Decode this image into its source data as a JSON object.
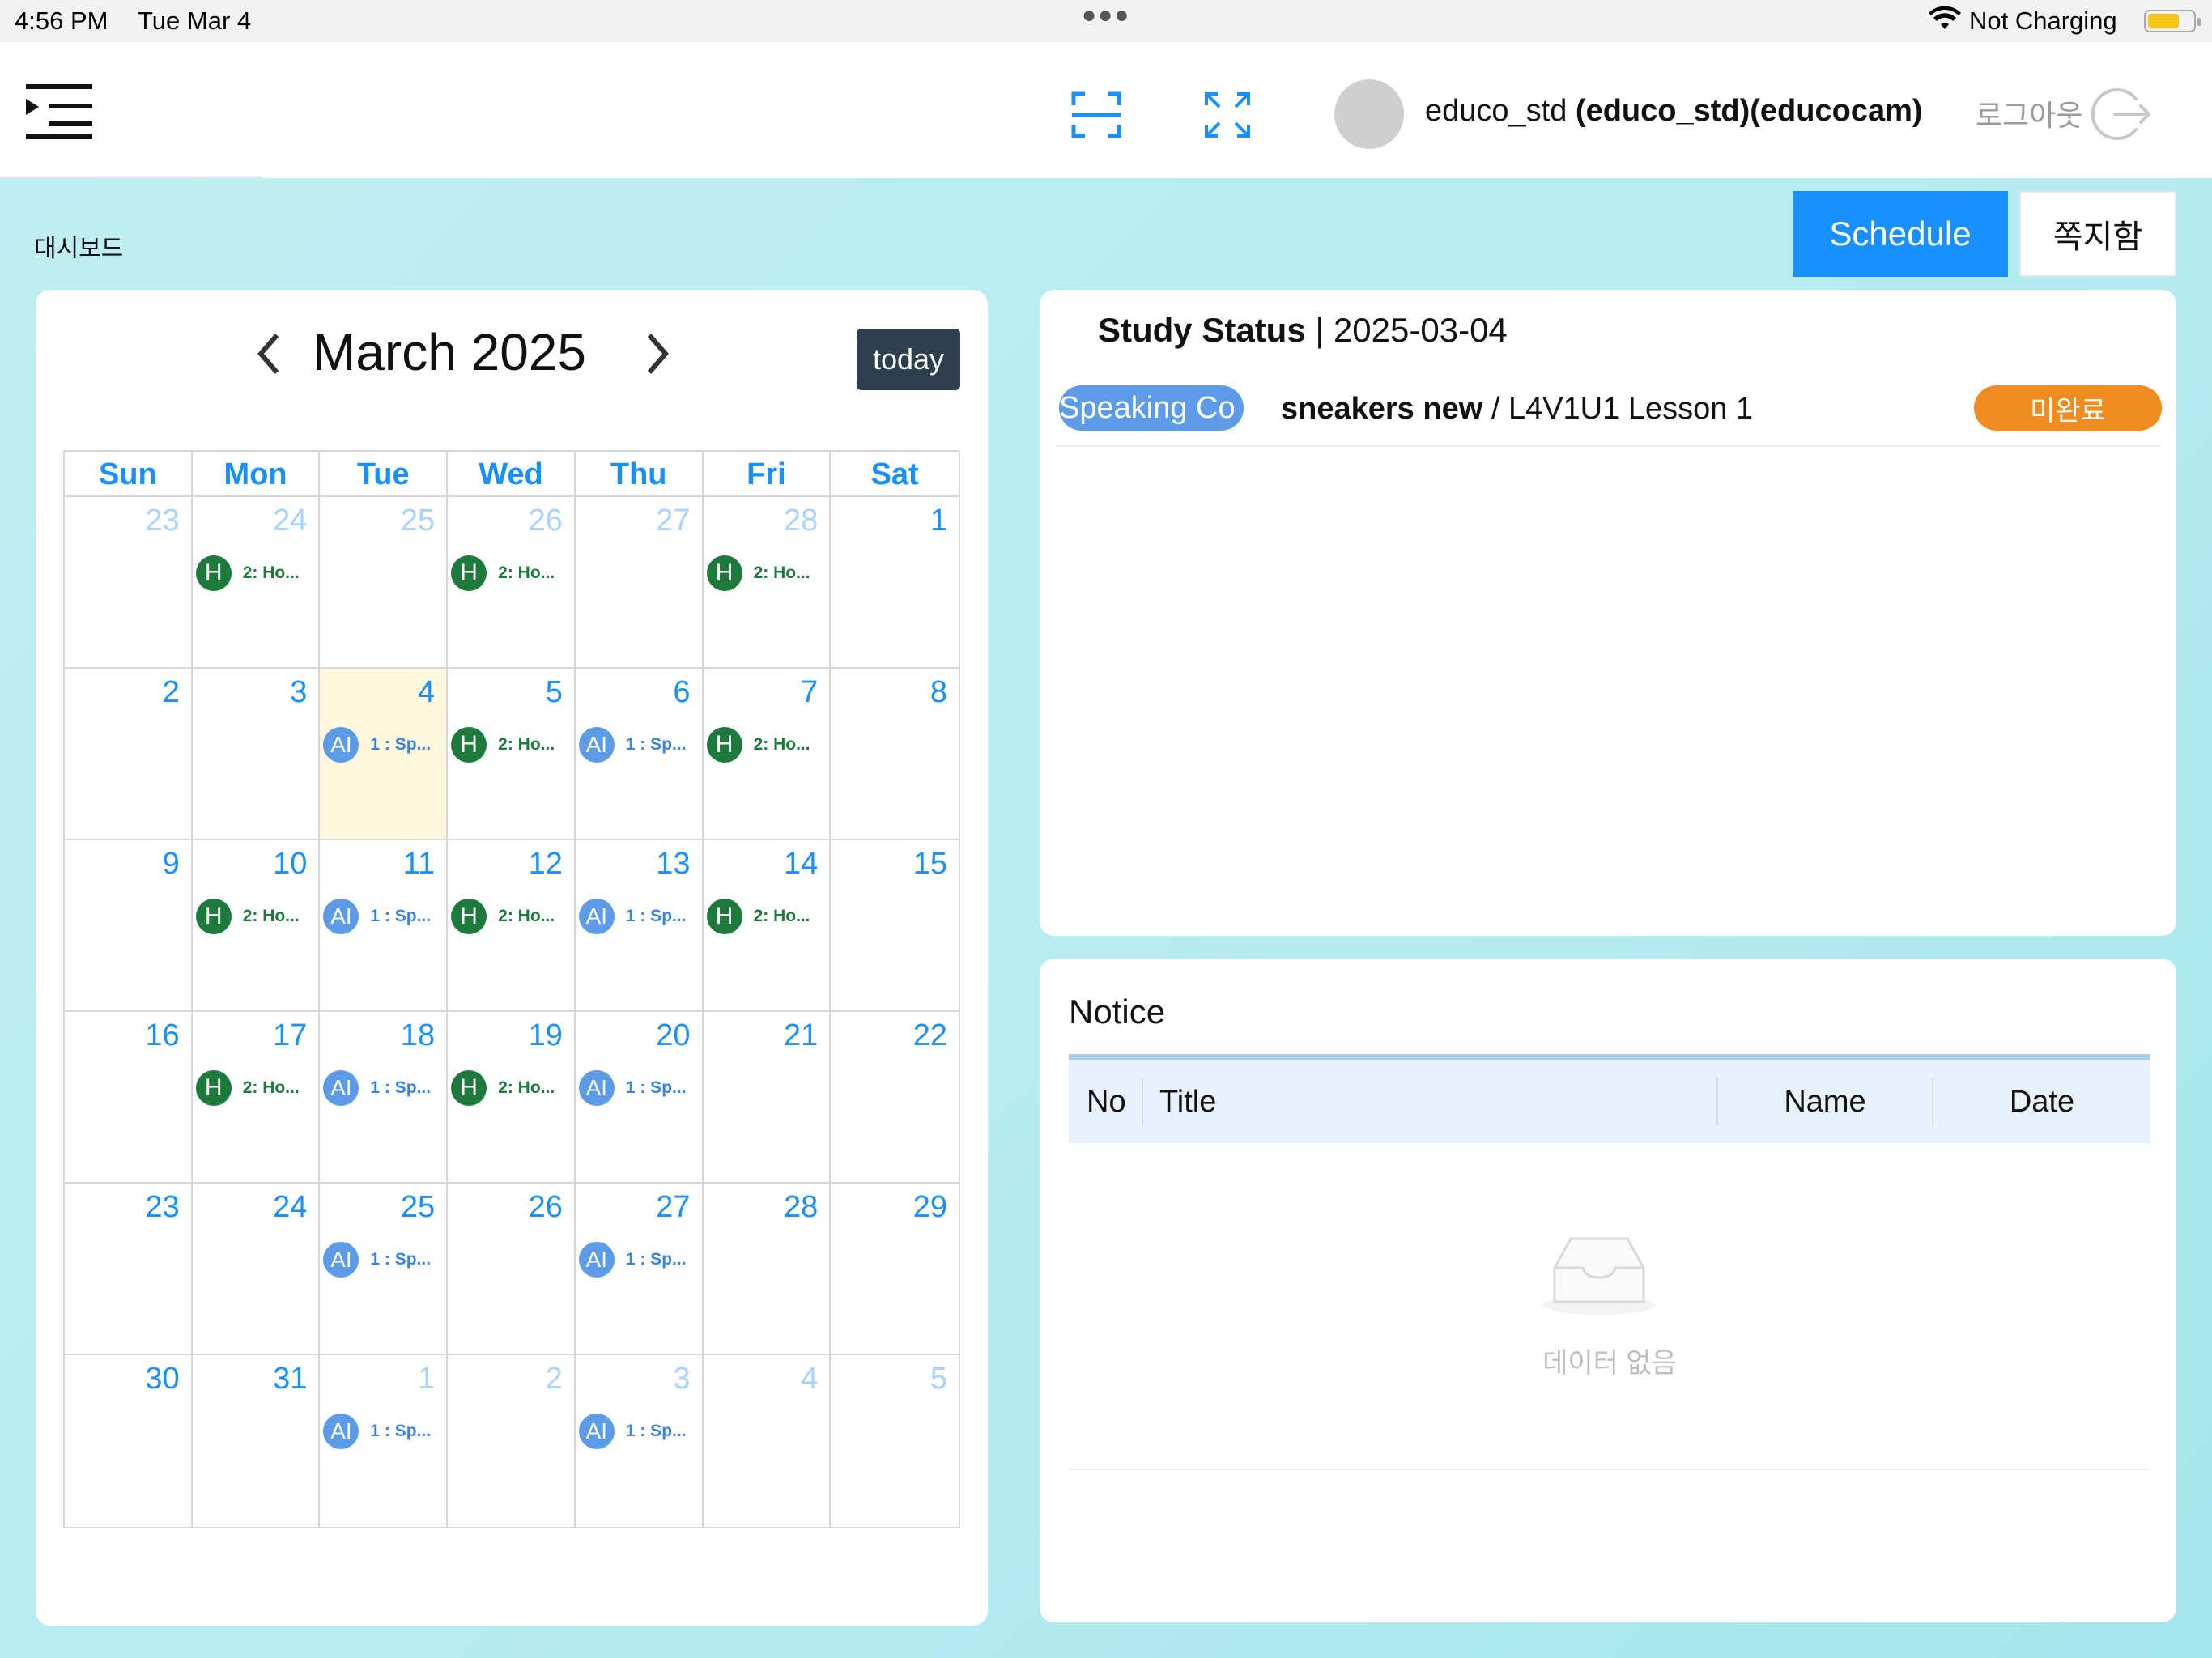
{
  "status_bar": {
    "time": "4:56 PM",
    "date": "Tue Mar 4",
    "battery_status": "Not Charging"
  },
  "header": {
    "user_plain": "educo_std ",
    "user_bold": "(educo_std)(educocam)",
    "logout_label": "로그아웃"
  },
  "breadcrumb": "대시보드",
  "top_buttons": {
    "schedule": "Schedule",
    "messages": "쪽지함"
  },
  "calendar": {
    "title": "March 2025",
    "today_label": "today",
    "weekdays": [
      "Sun",
      "Mon",
      "Tue",
      "Wed",
      "Thu",
      "Fri",
      "Sat"
    ],
    "today_date": 4,
    "weeks": [
      [
        {
          "d": "23",
          "other": true
        },
        {
          "d": "24",
          "other": true,
          "evt": {
            "badge": "H",
            "text": "2: Ho..."
          }
        },
        {
          "d": "25",
          "other": true
        },
        {
          "d": "26",
          "other": true,
          "evt": {
            "badge": "H",
            "text": "2: Ho..."
          }
        },
        {
          "d": "27",
          "other": true
        },
        {
          "d": "28",
          "other": true,
          "evt": {
            "badge": "H",
            "text": "2: Ho..."
          }
        },
        {
          "d": "1"
        }
      ],
      [
        {
          "d": "2"
        },
        {
          "d": "3"
        },
        {
          "d": "4",
          "today": true,
          "evt": {
            "badge": "AI",
            "text": "1 : Sp..."
          }
        },
        {
          "d": "5",
          "evt": {
            "badge": "H",
            "text": "2: Ho..."
          }
        },
        {
          "d": "6",
          "evt": {
            "badge": "AI",
            "text": "1 : Sp..."
          }
        },
        {
          "d": "7",
          "evt": {
            "badge": "H",
            "text": "2: Ho..."
          }
        },
        {
          "d": "8"
        }
      ],
      [
        {
          "d": "9"
        },
        {
          "d": "10",
          "evt": {
            "badge": "H",
            "text": "2: Ho..."
          }
        },
        {
          "d": "11",
          "evt": {
            "badge": "AI",
            "text": "1 : Sp..."
          }
        },
        {
          "d": "12",
          "evt": {
            "badge": "H",
            "text": "2: Ho..."
          }
        },
        {
          "d": "13",
          "evt": {
            "badge": "AI",
            "text": "1 : Sp..."
          }
        },
        {
          "d": "14",
          "evt": {
            "badge": "H",
            "text": "2: Ho..."
          }
        },
        {
          "d": "15"
        }
      ],
      [
        {
          "d": "16"
        },
        {
          "d": "17",
          "evt": {
            "badge": "H",
            "text": "2: Ho..."
          }
        },
        {
          "d": "18",
          "evt": {
            "badge": "AI",
            "text": "1 : Sp..."
          }
        },
        {
          "d": "19",
          "evt": {
            "badge": "H",
            "text": "2: Ho..."
          }
        },
        {
          "d": "20",
          "evt": {
            "badge": "AI",
            "text": "1 : Sp..."
          }
        },
        {
          "d": "21"
        },
        {
          "d": "22"
        }
      ],
      [
        {
          "d": "23"
        },
        {
          "d": "24"
        },
        {
          "d": "25",
          "evt": {
            "badge": "AI",
            "text": "1 : Sp..."
          }
        },
        {
          "d": "26"
        },
        {
          "d": "27",
          "evt": {
            "badge": "AI",
            "text": "1 : Sp..."
          }
        },
        {
          "d": "28"
        },
        {
          "d": "29"
        }
      ],
      [
        {
          "d": "30"
        },
        {
          "d": "31"
        },
        {
          "d": "1",
          "other": true,
          "evt": {
            "badge": "AI",
            "text": "1 : Sp..."
          }
        },
        {
          "d": "2",
          "other": true
        },
        {
          "d": "3",
          "other": true,
          "evt": {
            "badge": "AI",
            "text": "1 : Sp..."
          }
        },
        {
          "d": "4",
          "other": true
        },
        {
          "d": "5",
          "other": true
        }
      ]
    ]
  },
  "study_status": {
    "title_bold": "Study Status",
    "title_date": " | 2025-03-04",
    "tag": "Speaking Co",
    "lesson_bold": "sneakers new",
    "lesson_rest": " / L4V1U1 Lesson 1",
    "status": "미완료"
  },
  "notice": {
    "title": "Notice",
    "columns": {
      "no": "No",
      "title": "Title",
      "name": "Name",
      "date": "Date"
    },
    "empty_text": "데이터 없음"
  },
  "colors": {
    "accent": "#1890ff",
    "homework_green": "#1e7a3c",
    "ai_blue": "#5b9be8",
    "incomplete_orange": "#f08c1f",
    "today_bg": "#fff8dc"
  }
}
